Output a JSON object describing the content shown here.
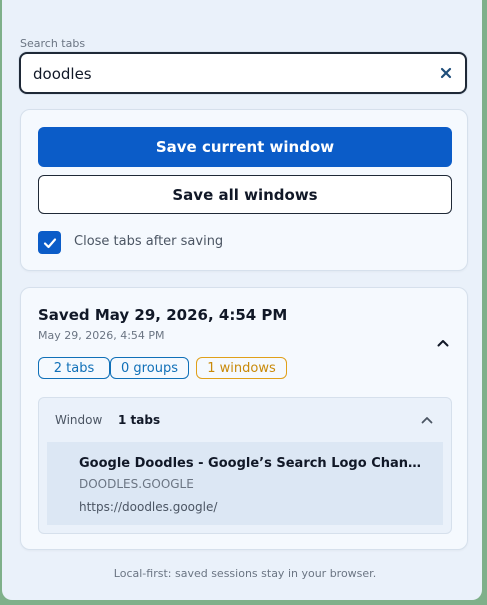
{
  "search": {
    "label": "Search tabs",
    "value": "doodles",
    "clear_icon": "close-icon"
  },
  "actions": {
    "save_current": "Save current window",
    "save_all": "Save all windows",
    "close_tabs_label": "Close tabs after saving",
    "close_tabs_checked": true
  },
  "session": {
    "title": "Saved May 29, 2026, 4:54 PM",
    "subtitle": "May 29, 2026, 4:54 PM",
    "badges": {
      "tabs": "2 tabs",
      "groups": "0 groups",
      "windows": "1 windows"
    },
    "window": {
      "label": "Window",
      "count": "1 tabs",
      "tabs": [
        {
          "title": "Google Doodles - Google’s Search Logo Changes fo...",
          "domain": "DOODLES.GOOGLE",
          "url": "https://doodles.google/"
        }
      ]
    }
  },
  "footer": "Local-first: saved sessions stay in your browser.",
  "colors": {
    "accent": "#0b5cc8",
    "badge_blue": "#1070b8",
    "badge_orange": "#e0a01a"
  }
}
